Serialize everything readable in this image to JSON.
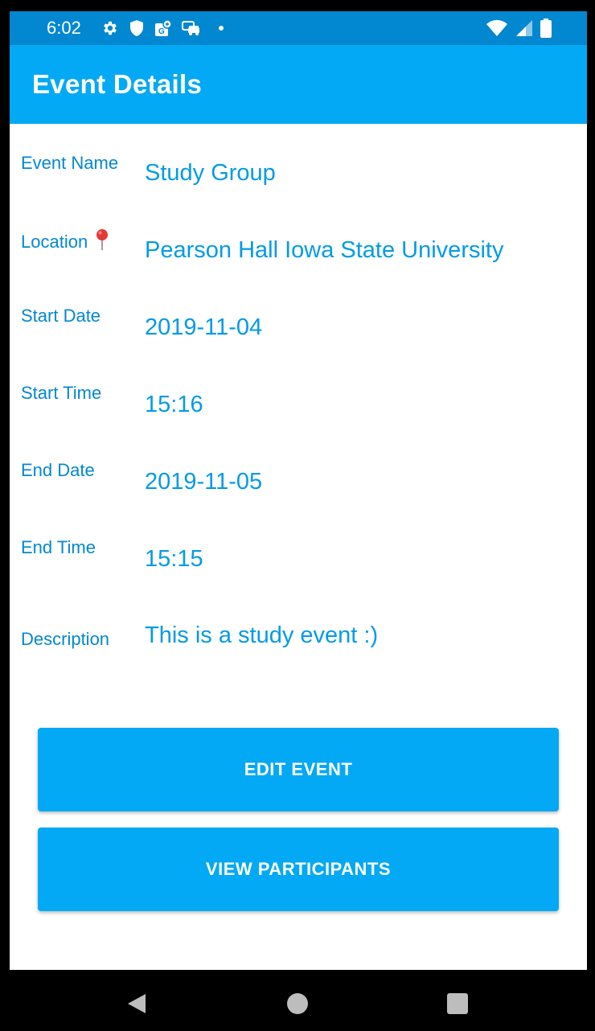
{
  "status_bar": {
    "time": "6:02",
    "icons_left": [
      "gear-icon",
      "shield-icon",
      "maps-icon",
      "car-icon",
      "notification-dot"
    ],
    "icons_right": [
      "wifi-icon",
      "signal-icon",
      "battery-icon"
    ]
  },
  "app_bar": {
    "title": "Event Details"
  },
  "details": {
    "event_name": {
      "label": "Event Name",
      "value": "Study Group"
    },
    "location": {
      "label": "Location",
      "icon": "📍",
      "value": "Pearson Hall Iowa State University"
    },
    "start_date": {
      "label": "Start Date",
      "value": "2019-11-04"
    },
    "start_time": {
      "label": "Start Time",
      "value": "15:16"
    },
    "end_date": {
      "label": "End Date",
      "value": "2019-11-05"
    },
    "end_time": {
      "label": "End Time",
      "value": "15:15"
    },
    "description": {
      "label": "Description",
      "value": "This is a study event :)"
    }
  },
  "buttons": {
    "edit_event": "EDIT EVENT",
    "view_participants": "VIEW PARTICIPANTS"
  },
  "colors": {
    "status_bar": "#0288D1",
    "app_bar": "#03A9F4",
    "label": "#0288D1",
    "value": "#039BE5",
    "button": "#03A9F4"
  },
  "nav_bar": {
    "icons": [
      "back-icon",
      "home-icon",
      "recents-icon"
    ]
  }
}
